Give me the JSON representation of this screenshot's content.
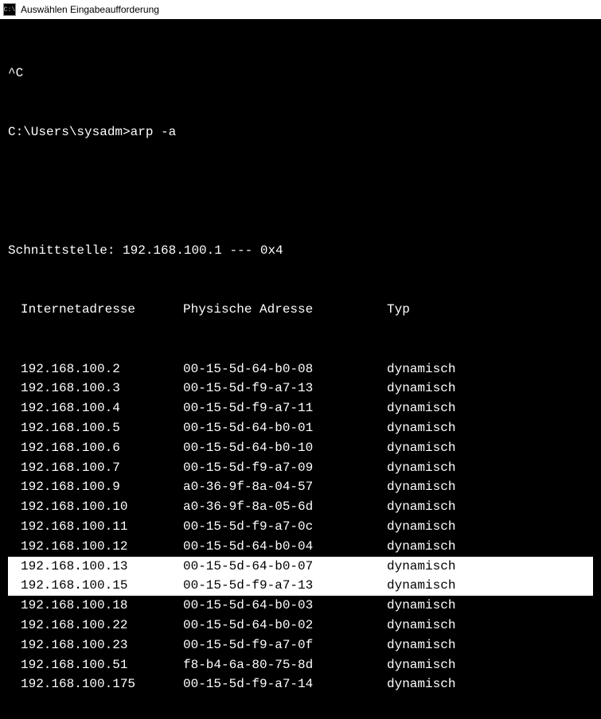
{
  "window": {
    "title": "Auswählen Eingabeaufforderung",
    "icon_text": "C:\\"
  },
  "terminal": {
    "interrupt": "^C",
    "prompt": "C:\\Users\\sysadm>",
    "command": "arp -a",
    "interface_line": "Schnittstelle: 192.168.100.1 --- 0x4",
    "headers": {
      "ip": "Internetadresse",
      "mac": "Physische Adresse",
      "type": "Typ"
    },
    "rows": [
      {
        "ip": "192.168.100.2",
        "mac": "00-15-5d-64-b0-08",
        "type": "dynamisch",
        "highlighted": false
      },
      {
        "ip": "192.168.100.3",
        "mac": "00-15-5d-f9-a7-13",
        "type": "dynamisch",
        "highlighted": false
      },
      {
        "ip": "192.168.100.4",
        "mac": "00-15-5d-f9-a7-11",
        "type": "dynamisch",
        "highlighted": false
      },
      {
        "ip": "192.168.100.5",
        "mac": "00-15-5d-64-b0-01",
        "type": "dynamisch",
        "highlighted": false
      },
      {
        "ip": "192.168.100.6",
        "mac": "00-15-5d-64-b0-10",
        "type": "dynamisch",
        "highlighted": false
      },
      {
        "ip": "192.168.100.7",
        "mac": "00-15-5d-f9-a7-09",
        "type": "dynamisch",
        "highlighted": false
      },
      {
        "ip": "192.168.100.9",
        "mac": "a0-36-9f-8a-04-57",
        "type": "dynamisch",
        "highlighted": false
      },
      {
        "ip": "192.168.100.10",
        "mac": "a0-36-9f-8a-05-6d",
        "type": "dynamisch",
        "highlighted": false
      },
      {
        "ip": "192.168.100.11",
        "mac": "00-15-5d-f9-a7-0c",
        "type": "dynamisch",
        "highlighted": false
      },
      {
        "ip": "192.168.100.12",
        "mac": "00-15-5d-64-b0-04",
        "type": "dynamisch",
        "highlighted": false
      },
      {
        "ip": "192.168.100.13",
        "mac": "00-15-5d-64-b0-07",
        "type": "dynamisch",
        "highlighted": true
      },
      {
        "ip": "192.168.100.15",
        "mac": "00-15-5d-f9-a7-13",
        "type": "dynamisch",
        "highlighted": true
      },
      {
        "ip": "192.168.100.18",
        "mac": "00-15-5d-64-b0-03",
        "type": "dynamisch",
        "highlighted": false
      },
      {
        "ip": "192.168.100.22",
        "mac": "00-15-5d-64-b0-02",
        "type": "dynamisch",
        "highlighted": false
      },
      {
        "ip": "192.168.100.23",
        "mac": "00-15-5d-f9-a7-0f",
        "type": "dynamisch",
        "highlighted": false
      },
      {
        "ip": "192.168.100.51",
        "mac": "f8-b4-6a-80-75-8d",
        "type": "dynamisch",
        "highlighted": false
      },
      {
        "ip": "192.168.100.175",
        "mac": "00-15-5d-f9-a7-14",
        "type": "dynamisch",
        "highlighted": false
      }
    ]
  }
}
